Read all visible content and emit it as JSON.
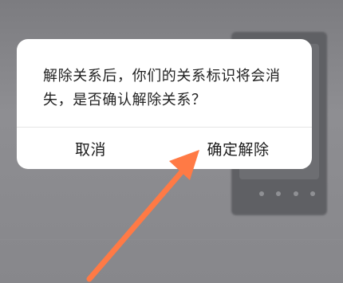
{
  "dialog": {
    "message": "解除关系后，你们的关系标识将会消失，是否确认解除关系？",
    "cancel_label": "取消",
    "confirm_label": "确定解除"
  },
  "annotation": {
    "arrow_color": "#ff7a45"
  },
  "colors": {
    "dialog_bg": "#ffffff",
    "text": "#222222",
    "overlay": "#8a8a8e"
  }
}
